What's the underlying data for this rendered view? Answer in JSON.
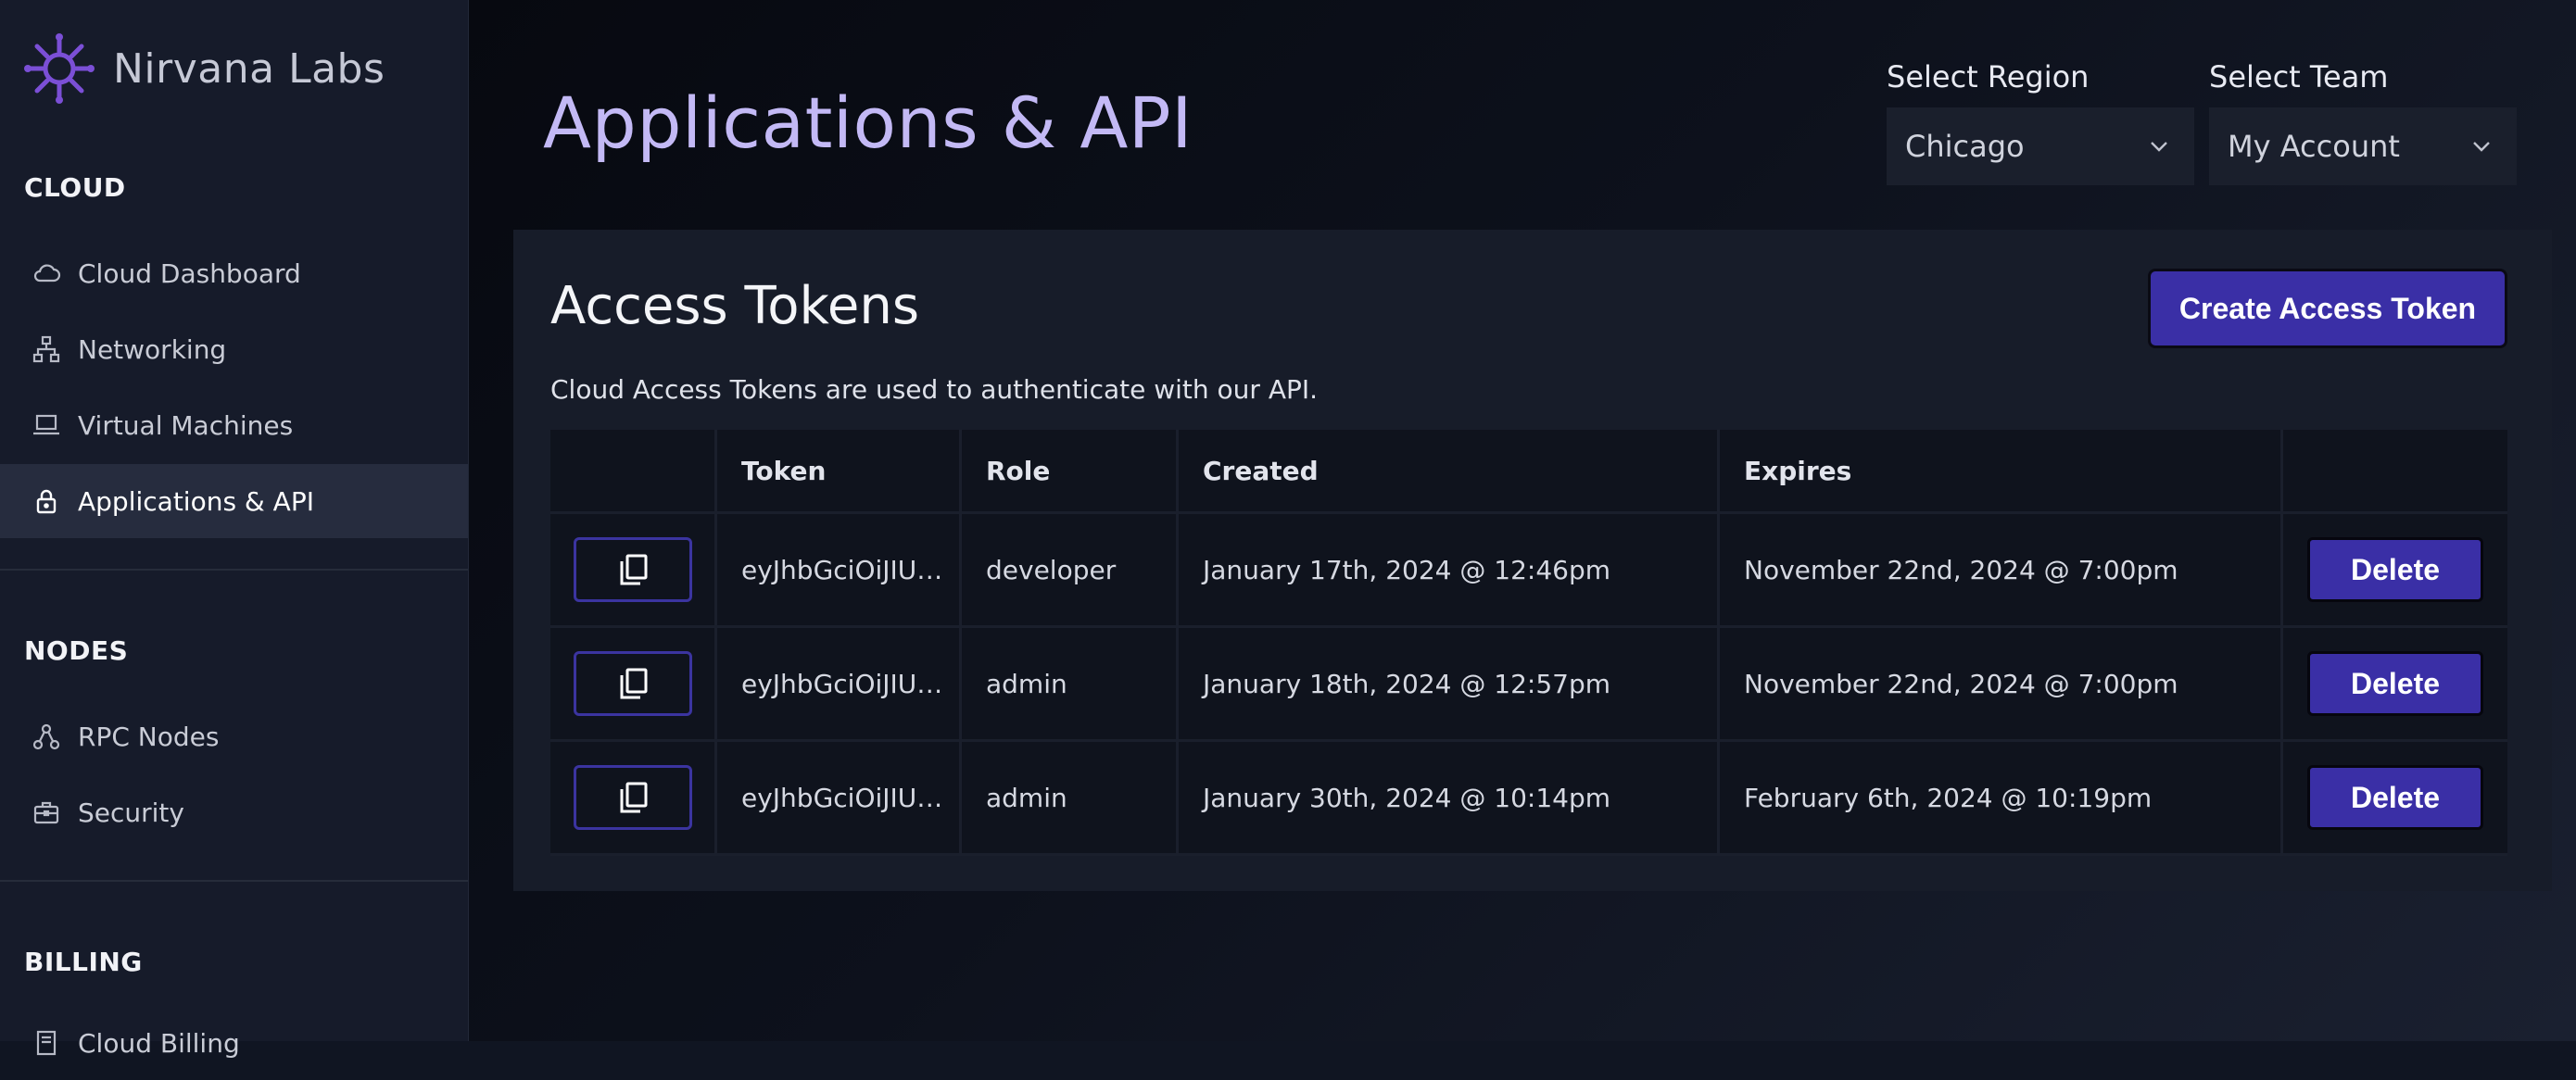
{
  "app": {
    "brand": "Nirvana Labs",
    "page_title": "Applications & API"
  },
  "sidebar": {
    "sections": [
      {
        "title": "CLOUD",
        "items": [
          {
            "label": "Cloud Dashboard",
            "icon": "cloud-icon"
          },
          {
            "label": "Networking",
            "icon": "network-icon"
          },
          {
            "label": "Virtual Machines",
            "icon": "laptop-icon"
          },
          {
            "label": "Applications & API",
            "icon": "lock-icon",
            "active": true
          }
        ]
      },
      {
        "title": "NODES",
        "items": [
          {
            "label": "RPC Nodes",
            "icon": "nodes-icon"
          },
          {
            "label": "Security",
            "icon": "briefcase-icon"
          }
        ]
      },
      {
        "title": "BILLING",
        "items": [
          {
            "label": "Cloud Billing",
            "icon": "receipt-icon"
          }
        ]
      }
    ]
  },
  "filters": {
    "region_label": "Select Region",
    "region_value": "Chicago",
    "team_label": "Select Team",
    "team_value": "My Account"
  },
  "tokens_card": {
    "title": "Access Tokens",
    "description": "Cloud Access Tokens are used to authenticate with our API.",
    "create_button": "Create Access Token",
    "columns": [
      "",
      "Token",
      "Role",
      "Created",
      "Expires",
      ""
    ],
    "rows": [
      {
        "token": "eyJhbGciOiJIU…",
        "role": "developer",
        "created": "January 17th, 2024 @ 12:46pm",
        "expires": "November 22nd, 2024 @ 7:00pm",
        "action": "Delete"
      },
      {
        "token": "eyJhbGciOiJIU…",
        "role": "admin",
        "created": "January 18th, 2024 @ 12:57pm",
        "expires": "November 22nd, 2024 @ 7:00pm",
        "action": "Delete"
      },
      {
        "token": "eyJhbGciOiJIU…",
        "role": "admin",
        "created": "January 30th, 2024 @ 10:14pm",
        "expires": "February 6th, 2024 @ 10:19pm",
        "action": "Delete"
      }
    ]
  },
  "colors": {
    "accent": "#3a2fa6",
    "title": "#c3b9f5",
    "logo": "#7b4fd6"
  }
}
